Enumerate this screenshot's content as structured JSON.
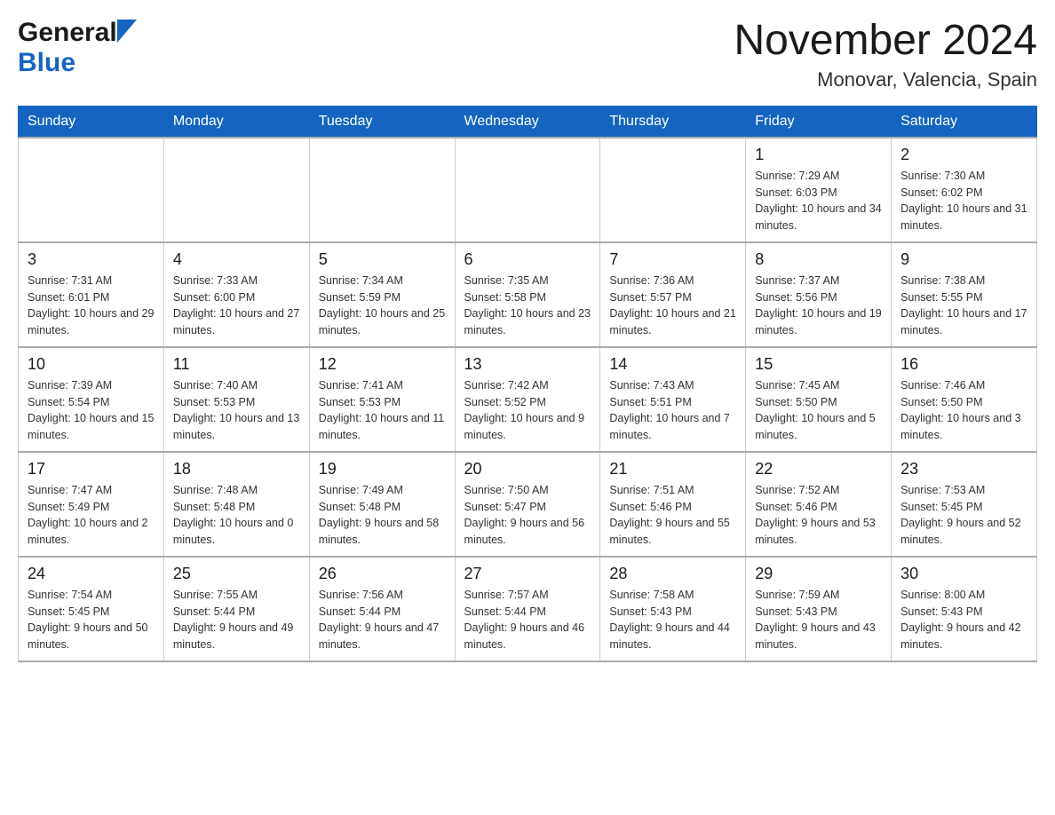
{
  "header": {
    "logo_general": "General",
    "logo_blue": "Blue",
    "month_title": "November 2024",
    "location": "Monovar, Valencia, Spain"
  },
  "days_of_week": [
    "Sunday",
    "Monday",
    "Tuesday",
    "Wednesday",
    "Thursday",
    "Friday",
    "Saturday"
  ],
  "weeks": [
    [
      {
        "day": "",
        "info": ""
      },
      {
        "day": "",
        "info": ""
      },
      {
        "day": "",
        "info": ""
      },
      {
        "day": "",
        "info": ""
      },
      {
        "day": "",
        "info": ""
      },
      {
        "day": "1",
        "info": "Sunrise: 7:29 AM\nSunset: 6:03 PM\nDaylight: 10 hours and 34 minutes."
      },
      {
        "day": "2",
        "info": "Sunrise: 7:30 AM\nSunset: 6:02 PM\nDaylight: 10 hours and 31 minutes."
      }
    ],
    [
      {
        "day": "3",
        "info": "Sunrise: 7:31 AM\nSunset: 6:01 PM\nDaylight: 10 hours and 29 minutes."
      },
      {
        "day": "4",
        "info": "Sunrise: 7:33 AM\nSunset: 6:00 PM\nDaylight: 10 hours and 27 minutes."
      },
      {
        "day": "5",
        "info": "Sunrise: 7:34 AM\nSunset: 5:59 PM\nDaylight: 10 hours and 25 minutes."
      },
      {
        "day": "6",
        "info": "Sunrise: 7:35 AM\nSunset: 5:58 PM\nDaylight: 10 hours and 23 minutes."
      },
      {
        "day": "7",
        "info": "Sunrise: 7:36 AM\nSunset: 5:57 PM\nDaylight: 10 hours and 21 minutes."
      },
      {
        "day": "8",
        "info": "Sunrise: 7:37 AM\nSunset: 5:56 PM\nDaylight: 10 hours and 19 minutes."
      },
      {
        "day": "9",
        "info": "Sunrise: 7:38 AM\nSunset: 5:55 PM\nDaylight: 10 hours and 17 minutes."
      }
    ],
    [
      {
        "day": "10",
        "info": "Sunrise: 7:39 AM\nSunset: 5:54 PM\nDaylight: 10 hours and 15 minutes."
      },
      {
        "day": "11",
        "info": "Sunrise: 7:40 AM\nSunset: 5:53 PM\nDaylight: 10 hours and 13 minutes."
      },
      {
        "day": "12",
        "info": "Sunrise: 7:41 AM\nSunset: 5:53 PM\nDaylight: 10 hours and 11 minutes."
      },
      {
        "day": "13",
        "info": "Sunrise: 7:42 AM\nSunset: 5:52 PM\nDaylight: 10 hours and 9 minutes."
      },
      {
        "day": "14",
        "info": "Sunrise: 7:43 AM\nSunset: 5:51 PM\nDaylight: 10 hours and 7 minutes."
      },
      {
        "day": "15",
        "info": "Sunrise: 7:45 AM\nSunset: 5:50 PM\nDaylight: 10 hours and 5 minutes."
      },
      {
        "day": "16",
        "info": "Sunrise: 7:46 AM\nSunset: 5:50 PM\nDaylight: 10 hours and 3 minutes."
      }
    ],
    [
      {
        "day": "17",
        "info": "Sunrise: 7:47 AM\nSunset: 5:49 PM\nDaylight: 10 hours and 2 minutes."
      },
      {
        "day": "18",
        "info": "Sunrise: 7:48 AM\nSunset: 5:48 PM\nDaylight: 10 hours and 0 minutes."
      },
      {
        "day": "19",
        "info": "Sunrise: 7:49 AM\nSunset: 5:48 PM\nDaylight: 9 hours and 58 minutes."
      },
      {
        "day": "20",
        "info": "Sunrise: 7:50 AM\nSunset: 5:47 PM\nDaylight: 9 hours and 56 minutes."
      },
      {
        "day": "21",
        "info": "Sunrise: 7:51 AM\nSunset: 5:46 PM\nDaylight: 9 hours and 55 minutes."
      },
      {
        "day": "22",
        "info": "Sunrise: 7:52 AM\nSunset: 5:46 PM\nDaylight: 9 hours and 53 minutes."
      },
      {
        "day": "23",
        "info": "Sunrise: 7:53 AM\nSunset: 5:45 PM\nDaylight: 9 hours and 52 minutes."
      }
    ],
    [
      {
        "day": "24",
        "info": "Sunrise: 7:54 AM\nSunset: 5:45 PM\nDaylight: 9 hours and 50 minutes."
      },
      {
        "day": "25",
        "info": "Sunrise: 7:55 AM\nSunset: 5:44 PM\nDaylight: 9 hours and 49 minutes."
      },
      {
        "day": "26",
        "info": "Sunrise: 7:56 AM\nSunset: 5:44 PM\nDaylight: 9 hours and 47 minutes."
      },
      {
        "day": "27",
        "info": "Sunrise: 7:57 AM\nSunset: 5:44 PM\nDaylight: 9 hours and 46 minutes."
      },
      {
        "day": "28",
        "info": "Sunrise: 7:58 AM\nSunset: 5:43 PM\nDaylight: 9 hours and 44 minutes."
      },
      {
        "day": "29",
        "info": "Sunrise: 7:59 AM\nSunset: 5:43 PM\nDaylight: 9 hours and 43 minutes."
      },
      {
        "day": "30",
        "info": "Sunrise: 8:00 AM\nSunset: 5:43 PM\nDaylight: 9 hours and 42 minutes."
      }
    ]
  ]
}
